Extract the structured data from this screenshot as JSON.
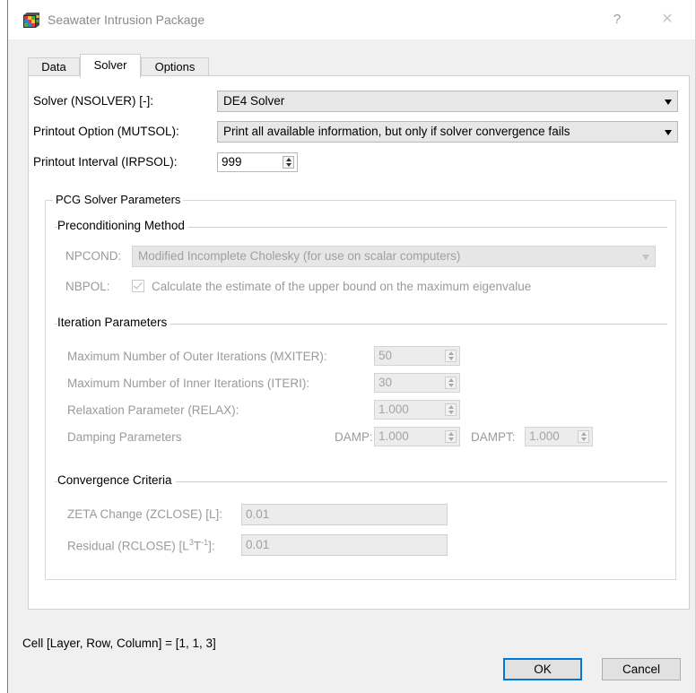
{
  "window": {
    "title": "Seawater Intrusion Package",
    "help_glyph": "?",
    "close_glyph": "✕"
  },
  "tabs": [
    {
      "label": "Data",
      "active": false
    },
    {
      "label": "Solver",
      "active": true
    },
    {
      "label": "Options",
      "active": false
    }
  ],
  "solver": {
    "label": "Solver (NSOLVER) [-]:",
    "value": "DE4 Solver"
  },
  "printout_option": {
    "label": "Printout Option (MUTSOL):",
    "value": "Print all available information, but only if solver convergence fails"
  },
  "printout_interval": {
    "label": "Printout Interval (IRPSOL):",
    "value": "999"
  },
  "pcg": {
    "group_title": "PCG Solver Parameters",
    "preconditioning": {
      "heading": "Preconditioning Method",
      "npcond_label": "NPCOND:",
      "npcond_value": "Modified Incomplete Cholesky (for use on scalar computers)",
      "nbpol_label": "NBPOL:",
      "nbpol_checkbox_label": "Calculate the estimate of the upper bound on the maximum eigenvalue",
      "nbpol_checked": true
    },
    "iteration": {
      "heading": "Iteration Parameters",
      "mxiter_label": "Maximum Number of Outer Iterations (MXITER):",
      "mxiter_value": "50",
      "iteri_label": "Maximum Number of Inner Iterations (ITERI):",
      "iteri_value": "30",
      "relax_label": "Relaxation Parameter (RELAX):",
      "relax_value": "1.000",
      "damping_label": "Damping Parameters",
      "damp_label": "DAMP:",
      "damp_value": "1.000",
      "dampt_label": "DAMPT:",
      "dampt_value": "1.000"
    },
    "convergence": {
      "heading": "Convergence Criteria",
      "zclose_label": "ZETA Change (ZCLOSE) [L]:",
      "zclose_value": "0.01",
      "rclose_label_pre": "Residual (RCLOSE) [L",
      "rclose_sup1": "3",
      "rclose_mid": "T",
      "rclose_sup2": "-1",
      "rclose_label_post": "]:",
      "rclose_value": "0.01"
    }
  },
  "status_text": "Cell [Layer, Row, Column] = [1, 1, 3]",
  "buttons": {
    "ok": "OK",
    "cancel": "Cancel"
  },
  "colors": {
    "default_button_border": "#0078d7",
    "disabled_text": "#9a9a9a"
  },
  "icons": {
    "app": "grid-cube-icon",
    "combo_arrow": "chevron-down-icon",
    "spinner": "spinner-arrows-icon",
    "checkbox": "checkmark-icon"
  }
}
